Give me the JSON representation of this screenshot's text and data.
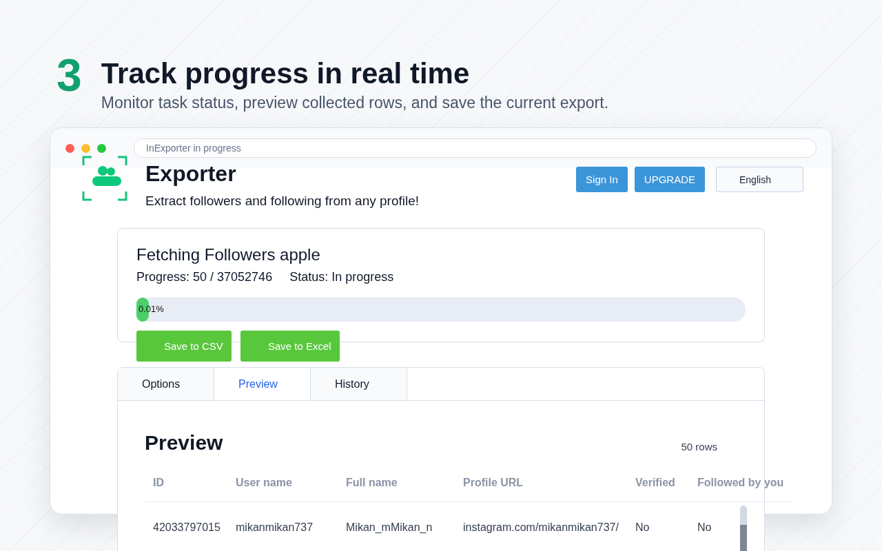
{
  "step": {
    "number": "3",
    "title": "Track progress in real time",
    "subtitle": "Monitor task status, preview collected rows, and save the current export."
  },
  "window": {
    "address": "InExporter in progress"
  },
  "app": {
    "title": "Exporter",
    "tagline": "Extract followers and following from any profile!",
    "buttons": [
      "Sign In",
      "UPGRADE"
    ],
    "language": "English"
  },
  "task": {
    "title": "Fetching Followers apple",
    "progress": "Progress: 50 / 37052746",
    "status": "Status: In progress",
    "level": 0.0001,
    "percent": "0.01%",
    "actions": [
      "Save to CSV",
      "Save to Excel"
    ]
  },
  "tabs": [
    {
      "label": "Options",
      "selected": false
    },
    {
      "label": "Preview",
      "selected": true
    },
    {
      "label": "History",
      "selected": false
    }
  ],
  "preview": {
    "title": "Preview",
    "count": "50 rows",
    "columns": [
      "ID",
      "User name",
      "Full name",
      "Profile URL",
      "Verified",
      "Followed by you"
    ],
    "rows": [
      [
        "42033797015",
        "mikanmikan737",
        "Mikan_mMikan_n",
        "instagram.com/mikanmikan737/",
        "No",
        "No"
      ]
    ]
  }
}
